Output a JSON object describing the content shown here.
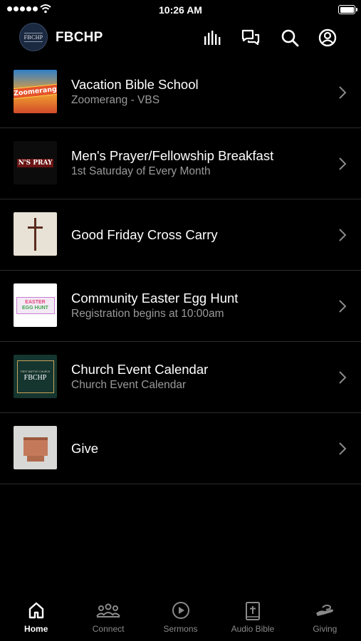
{
  "status_bar": {
    "time": "10:26 AM"
  },
  "header": {
    "logo_text": "FBCHP",
    "title": "FBCHP",
    "icons": [
      "equalizer-icon",
      "chat-icon",
      "search-icon",
      "account-icon"
    ]
  },
  "items": [
    {
      "title": "Vacation Bible School",
      "subtitle": "Zoomerang - VBS",
      "thumb_text": "Zoomerang"
    },
    {
      "title": "Men's Prayer/Fellowship Breakfast",
      "subtitle": "1st Saturday of Every Month",
      "thumb_text": "N'S PRAY"
    },
    {
      "title": "Good Friday Cross Carry",
      "subtitle": ""
    },
    {
      "title": "Community Easter Egg Hunt",
      "subtitle": "Registration begins at 10:00am",
      "thumb_text": [
        "EASTER",
        "EGG HUNT"
      ]
    },
    {
      "title": "Church Event Calendar",
      "subtitle": "Church Event Calendar",
      "thumb_text": [
        "FIRST BAPTIST CHURCH",
        "FBCHP"
      ]
    },
    {
      "title": "Give",
      "subtitle": ""
    }
  ],
  "tabs": [
    {
      "label": "Home",
      "icon": "home-icon",
      "active": true
    },
    {
      "label": "Connect",
      "icon": "people-icon",
      "active": false
    },
    {
      "label": "Sermons",
      "icon": "play-icon",
      "active": false
    },
    {
      "label": "Audio Bible",
      "icon": "bible-icon",
      "active": false
    },
    {
      "label": "Giving",
      "icon": "giving-hand-icon",
      "active": false
    }
  ],
  "colors": {
    "background": "#000000",
    "text": "#ffffff",
    "subtitle": "#9a9a9a",
    "tab_inactive": "#8a8a8a",
    "divider": "#2b2b2b"
  }
}
